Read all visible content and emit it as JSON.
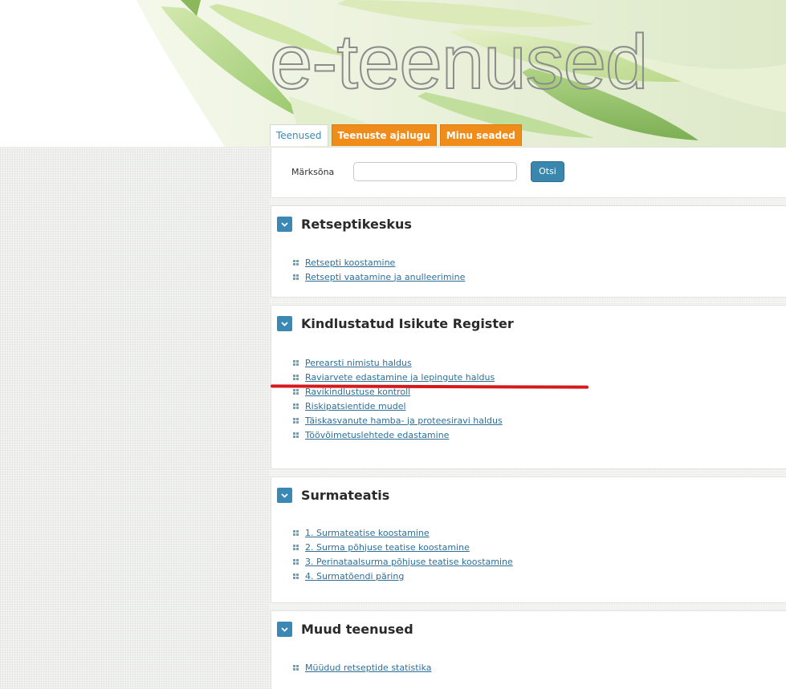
{
  "header": {
    "logo_text": "e-teenused"
  },
  "tabs": [
    {
      "label": "Teenused",
      "active": true
    },
    {
      "label": "Teenuste ajalugu",
      "active": false
    },
    {
      "label": "Minu seaded",
      "active": false
    }
  ],
  "search": {
    "label": "Märksõna",
    "value": "",
    "placeholder": "",
    "button_label": "Otsi"
  },
  "sections": [
    {
      "title": "Retseptikeskus",
      "links": [
        "Retsepti koostamine",
        "Retsepti vaatamine ja anulleerimine"
      ]
    },
    {
      "title": "Kindlustatud Isikute Register",
      "links": [
        "Perearsti nimistu haldus",
        "Raviarvete edastamine ja lepingute haldus",
        "Ravikindlustuse kontroll",
        "Riskipatsientide mudel",
        "Täiskasvanute hamba- ja proteesiravi haldus",
        "Töövõimetuslehtede edastamine"
      ]
    },
    {
      "title": "Surmateatis",
      "links": [
        "1. Surmateatise koostamine",
        "2. Surma põhjuse teatise koostamine",
        "3. Perinataalsurma põhjuse teatise koostamine",
        "4. Surmatõendi päring"
      ]
    },
    {
      "title": "Muud teenused",
      "links": [
        "Müüdud retseptide statistika"
      ]
    }
  ],
  "colors": {
    "accent_blue": "#3c88b4",
    "tab_orange": "#f08c1a",
    "link": "#2d6f98",
    "annotation_red": "#d41a1a"
  }
}
